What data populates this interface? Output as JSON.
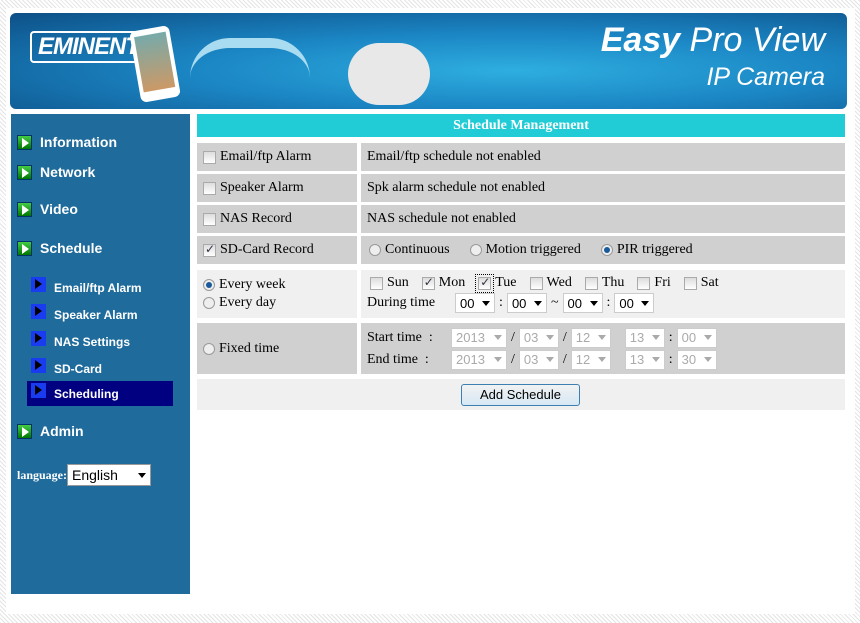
{
  "banner": {
    "logo": "EMINENT",
    "brand_bold": "Easy",
    "brand_rest": " Pro View",
    "subtitle": "IP Camera"
  },
  "sidebar": {
    "items": [
      {
        "label": "Information"
      },
      {
        "label": "Network"
      },
      {
        "label": "Video"
      },
      {
        "label": "Schedule"
      },
      {
        "label": "Admin"
      }
    ],
    "sub_items": [
      {
        "label": "Email/ftp Alarm"
      },
      {
        "label": "Speaker Alarm"
      },
      {
        "label": "NAS Settings"
      },
      {
        "label": "SD-Card"
      },
      {
        "label": "Scheduling",
        "selected": true
      }
    ],
    "language_label": "language:",
    "language_value": "English"
  },
  "main": {
    "title": "Schedule Management",
    "rows": [
      {
        "label": "Email/ftp Alarm",
        "checked": false,
        "status": "Email/ftp schedule not enabled"
      },
      {
        "label": "Speaker Alarm",
        "checked": false,
        "status": "Spk alarm schedule not enabled"
      },
      {
        "label": "NAS Record",
        "checked": false,
        "status": "NAS schedule not enabled"
      },
      {
        "label": "SD-Card Record",
        "checked": true
      }
    ],
    "record_modes": [
      {
        "label": "Continuous",
        "selected": false
      },
      {
        "label": "Motion triggered",
        "selected": false
      },
      {
        "label": "PIR triggered",
        "selected": true
      }
    ],
    "every_week": "Every week",
    "every_day": "Every day",
    "fixed_time": "Fixed time",
    "repeat_selected": "Every week",
    "days": [
      {
        "label": "Sun",
        "checked": false
      },
      {
        "label": "Mon",
        "checked": true
      },
      {
        "label": "Tue",
        "checked": true
      },
      {
        "label": "Wed",
        "checked": false
      },
      {
        "label": "Thu",
        "checked": false
      },
      {
        "label": "Fri",
        "checked": false
      },
      {
        "label": "Sat",
        "checked": false
      }
    ],
    "during_time_label": "During time",
    "during": {
      "h1": "00",
      "m1": "00",
      "h2": "00",
      "m2": "00",
      "colon": ":",
      "tilde": "~"
    },
    "start_label": "Start time  :",
    "end_label": "End time  :",
    "start": {
      "year": "2013",
      "month": "03",
      "day": "12",
      "hour": "13",
      "minute": "00"
    },
    "end": {
      "year": "2013",
      "month": "03",
      "day": "12",
      "hour": "13",
      "minute": "30"
    },
    "slash": "/",
    "add_button": "Add Schedule"
  }
}
